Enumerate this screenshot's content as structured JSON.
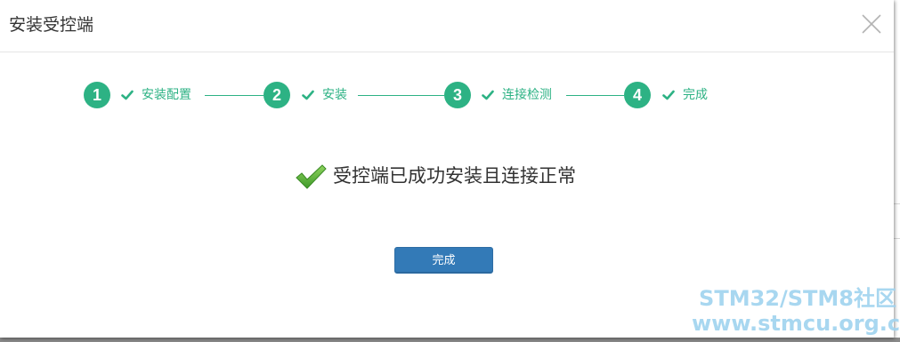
{
  "dialog": {
    "title": "安装受控端",
    "close_icon": "close-icon"
  },
  "steps": [
    {
      "number": "1",
      "label": "安装配置",
      "status": "completed"
    },
    {
      "number": "2",
      "label": "安装",
      "status": "completed"
    },
    {
      "number": "3",
      "label": "连接检测",
      "status": "completed"
    },
    {
      "number": "4",
      "label": "完成",
      "status": "completed"
    }
  ],
  "result": {
    "icon": "success-check-icon",
    "message": "受控端已成功安装且连接正常"
  },
  "footer": {
    "finish_label": "完成"
  },
  "watermark": {
    "line1": "STM32/STM8社区",
    "line2": "www.stmcu.org.cn"
  },
  "colors": {
    "step_accent": "#2db284",
    "primary_button": "#337ab7",
    "success_icon": "#5cb33a"
  }
}
